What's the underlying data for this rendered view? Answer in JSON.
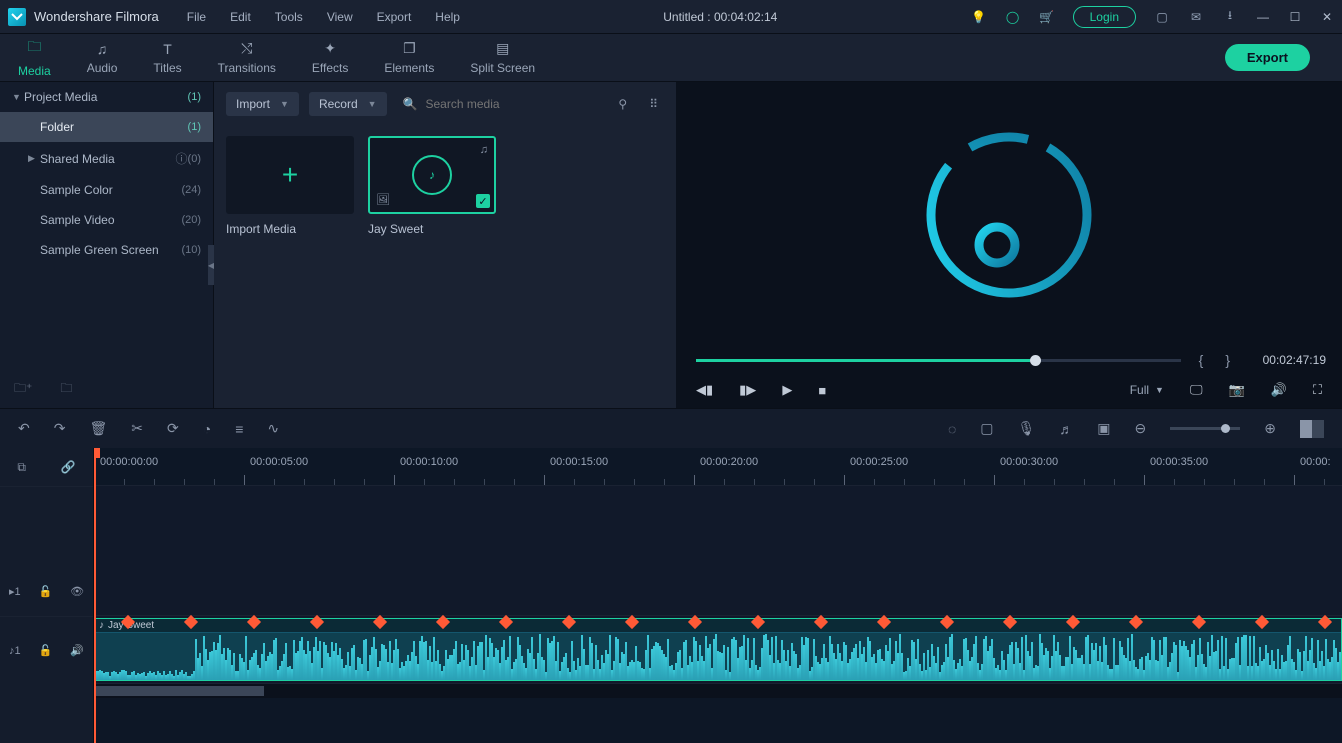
{
  "app": {
    "name": "Wondershare Filmora"
  },
  "menu": {
    "file": "File",
    "edit": "Edit",
    "tools": "Tools",
    "view": "View",
    "export": "Export",
    "help": "Help"
  },
  "title": {
    "document": "Untitled : 00:04:02:14"
  },
  "header": {
    "login": "Login"
  },
  "tabs": {
    "media": "Media",
    "audio": "Audio",
    "titles": "Titles",
    "transitions": "Transitions",
    "effects": "Effects",
    "elements": "Elements",
    "splitscreen": "Split Screen",
    "export_btn": "Export"
  },
  "sidebar": {
    "project": {
      "label": "Project Media",
      "count": "(1)"
    },
    "folder": {
      "label": "Folder",
      "count": "(1)"
    },
    "shared": {
      "label": "Shared Media",
      "count": "(0)"
    },
    "sample_color": {
      "label": "Sample Color",
      "count": "(24)"
    },
    "sample_video": {
      "label": "Sample Video",
      "count": "(20)"
    },
    "sample_green": {
      "label": "Sample Green Screen",
      "count": "(10)"
    }
  },
  "browser": {
    "import": "Import",
    "record": "Record",
    "search_placeholder": "Search media",
    "import_media_label": "Import Media",
    "clip1_label": "Jay Sweet"
  },
  "preview": {
    "timecode": "00:02:47:19",
    "quality": "Full"
  },
  "ruler": {
    "t0": "00:00:00:00",
    "t1": "00:00:05:00",
    "t2": "00:00:10:00",
    "t3": "00:00:15:00",
    "t4": "00:00:20:00",
    "t5": "00:00:25:00",
    "t6": "00:00:30:00",
    "t7": "00:00:35:00",
    "t8": "00:00:"
  },
  "tracks": {
    "v1": "1",
    "a1": "1",
    "vlabel": "▸",
    "audio_clip_name": "Jay Sweet"
  }
}
